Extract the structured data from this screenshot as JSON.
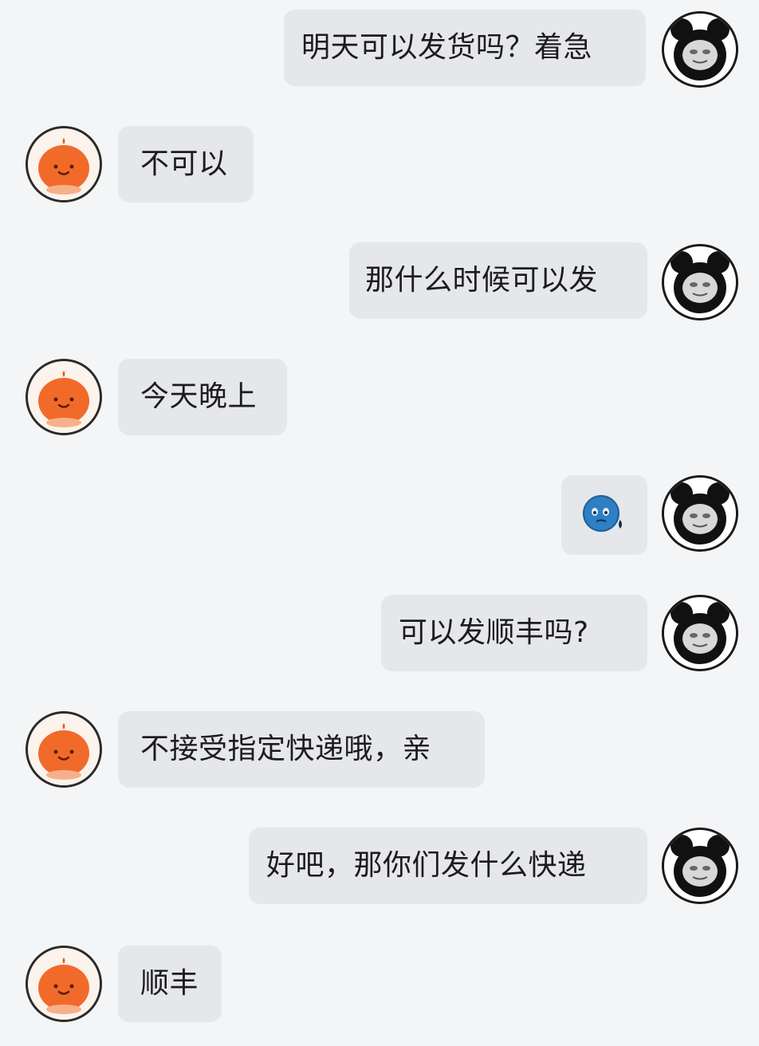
{
  "conversation": {
    "messages": [
      {
        "sender": "user",
        "type": "text",
        "text": "明天可以发货吗？着急"
      },
      {
        "sender": "shop",
        "type": "text",
        "text": "不可以"
      },
      {
        "sender": "user",
        "type": "text",
        "text": "那什么时候可以发"
      },
      {
        "sender": "shop",
        "type": "text",
        "text": "今天晚上"
      },
      {
        "sender": "user",
        "type": "emoji",
        "emoji": "sweat-face-icon"
      },
      {
        "sender": "user",
        "type": "text",
        "text": "可以发顺丰吗?"
      },
      {
        "sender": "shop",
        "type": "text",
        "text": "不接受指定快递哦，亲"
      },
      {
        "sender": "user",
        "type": "text",
        "text": "好吧，那你们发什么快递"
      },
      {
        "sender": "shop",
        "type": "text",
        "text": "顺丰"
      }
    ]
  },
  "avatars": {
    "shop": {
      "icon": "orange-mascot-avatar-icon",
      "color": "#f26a2a"
    },
    "user": {
      "icon": "panda-meme-avatar-icon",
      "color": "#111111"
    }
  },
  "colors": {
    "background": "#f4f5f7",
    "bubble": "#e6e7ea",
    "text": "#1c1c1e",
    "emoji": "#2e7fc4"
  }
}
